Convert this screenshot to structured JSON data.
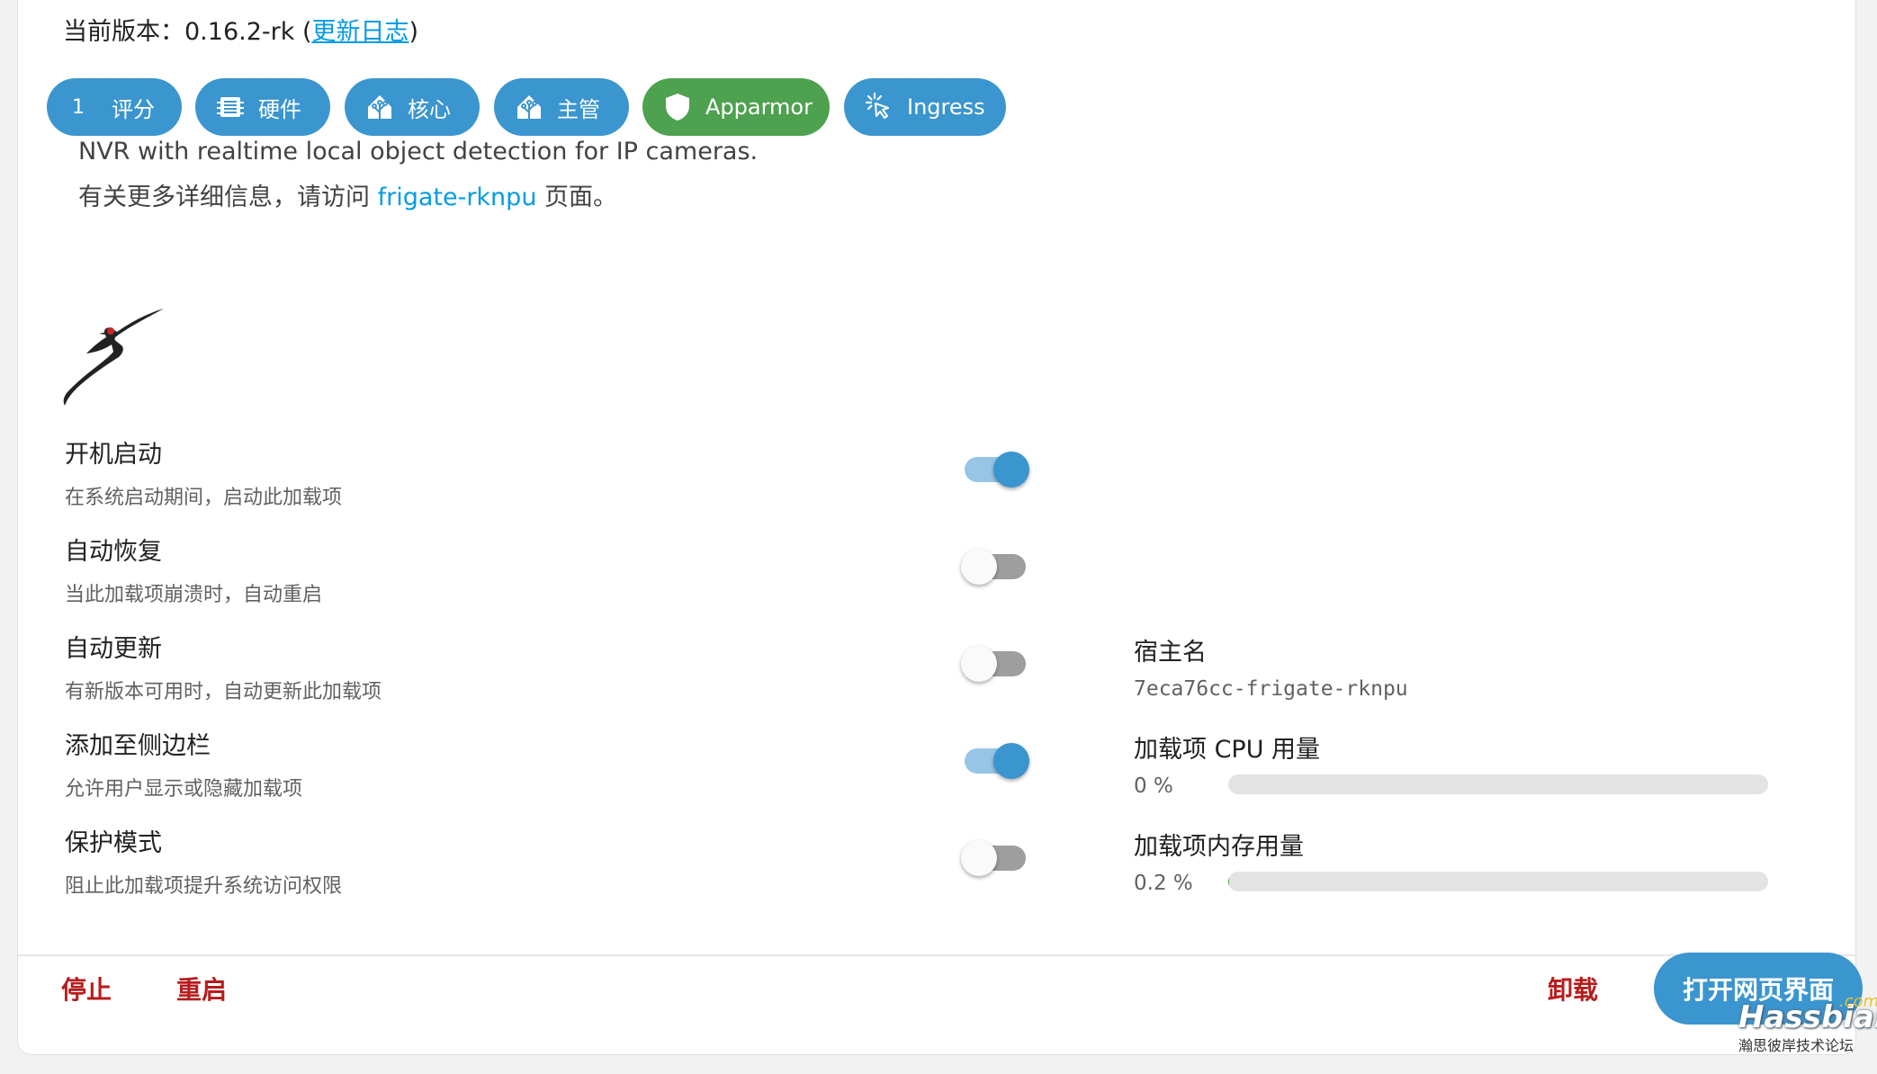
{
  "header": {
    "version_prefix": "当前版本：0.16.2-rk (",
    "changelog_link": "更新日志",
    "version_suffix": ")"
  },
  "chips": [
    {
      "number": "1",
      "label": "评分",
      "icon": "rating-number"
    },
    {
      "label": "硬件",
      "icon": "chip-icon"
    },
    {
      "label": "核心",
      "icon": "home-assistant-icon"
    },
    {
      "label": "主管",
      "icon": "home-assistant-icon"
    },
    {
      "label": "Apparmor",
      "icon": "shield-icon"
    },
    {
      "label": "Ingress",
      "icon": "cursor-click-icon"
    }
  ],
  "description": {
    "line1": "NVR with realtime local object detection for IP cameras.",
    "line2_prefix": "有关更多详细信息，请访问 ",
    "line2_link": "frigate-rknpu",
    "line2_suffix": " 页面。"
  },
  "logo": {
    "icon": "frigate-bird-logo"
  },
  "options": [
    {
      "title": "开机启动",
      "subtitle": "在系统启动期间，启动此加载项",
      "enabled": true
    },
    {
      "title": "自动恢复",
      "subtitle": "当此加载项崩溃时，自动重启",
      "enabled": false
    },
    {
      "title": "自动更新",
      "subtitle": "有新版本可用时，自动更新此加载项",
      "enabled": false
    },
    {
      "title": "添加至侧边栏",
      "subtitle": "允许用户显示或隐藏加载项",
      "enabled": true
    },
    {
      "title": "保护模式",
      "subtitle": "阻止此加载项提升系统访问权限",
      "enabled": false
    }
  ],
  "info": {
    "hostname_label": "宿主名",
    "hostname_value": "7eca76cc-frigate-rknpu",
    "cpu_label": "加载项 CPU 用量",
    "cpu_value": "0 %",
    "cpu_percent": 0,
    "mem_label": "加载项内存用量",
    "mem_value": "0.2 %",
    "mem_percent": 0.2
  },
  "actions": {
    "stop": "停止",
    "restart": "重启",
    "uninstall": "卸载",
    "open_web_ui": "打开网页界面"
  },
  "watermark": {
    "brand": "Hassbian",
    "com": ".com",
    "subtitle": "瀚思彼岸技术论坛"
  },
  "colors": {
    "primary": "#3b95cf",
    "green": "#4ea14f",
    "danger": "#b71c1c",
    "link": "#039be5"
  }
}
